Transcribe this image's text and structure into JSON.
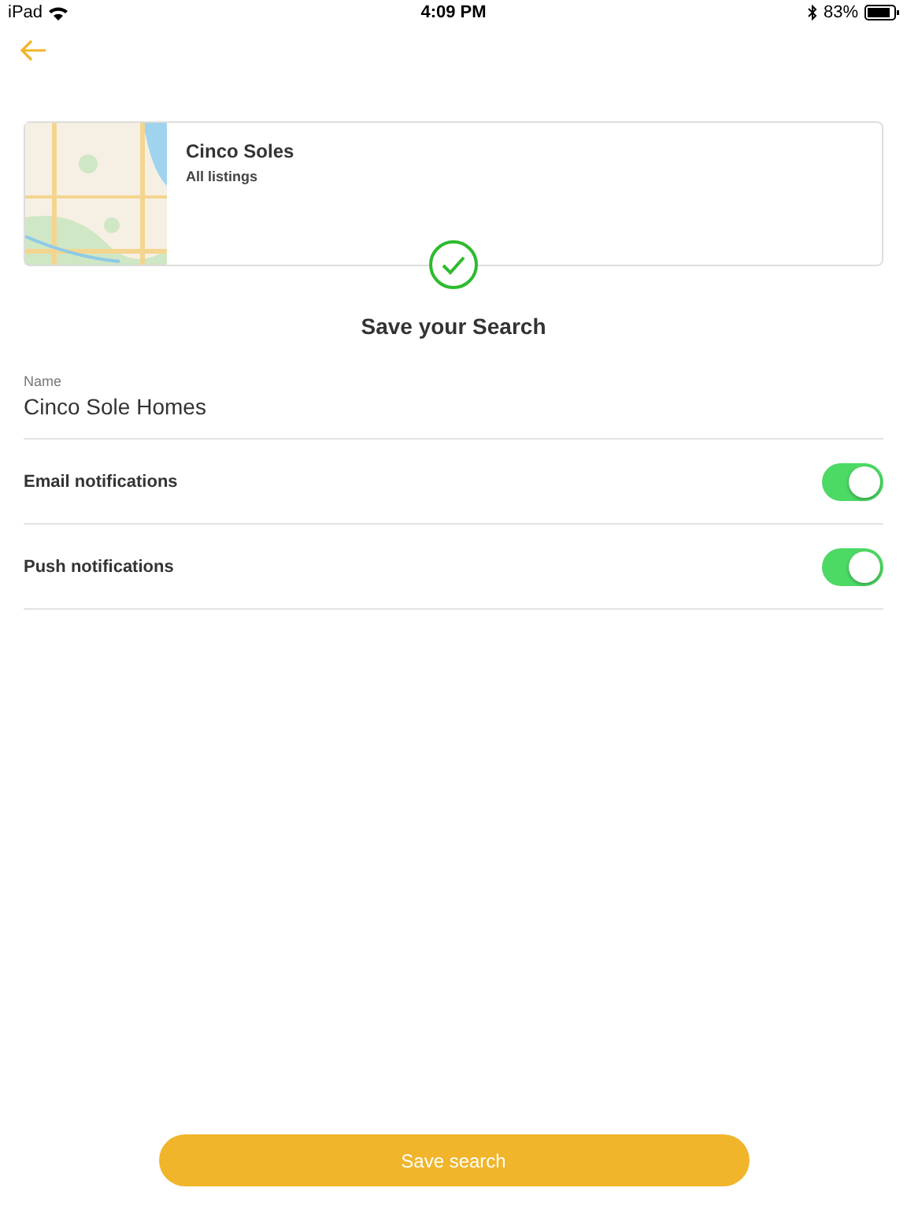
{
  "status_bar": {
    "device": "iPad",
    "time": "4:09 PM",
    "battery": "83%"
  },
  "search_card": {
    "title": "Cinco Soles",
    "subtitle": "All listings"
  },
  "heading": "Save your Search",
  "name_field": {
    "label": "Name",
    "value": "Cinco Sole Homes"
  },
  "settings": [
    {
      "label": "Email notifications",
      "on": true
    },
    {
      "label": "Push notifications",
      "on": true
    }
  ],
  "save_button": "Save search"
}
